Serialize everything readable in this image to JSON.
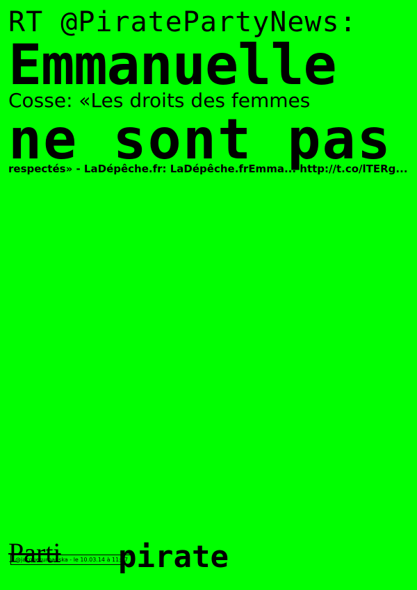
{
  "poster": {
    "line1": "RT @PiratePartyNews:",
    "line2": "Emmanuelle",
    "line3": "Cosse: «Les droits des femmes",
    "line4": "ne sont pas",
    "line5": "respectés» - LaDépêche.fr: LaDépêche.frEmma... http://t.co/lTERg..."
  },
  "logo": {
    "part1": "Parti",
    "part2": "pirate"
  },
  "credit": "@jacquesurbanska - le 10.03.14 à 11:17",
  "colors": {
    "background": "#00ff00",
    "text": "#000000"
  }
}
